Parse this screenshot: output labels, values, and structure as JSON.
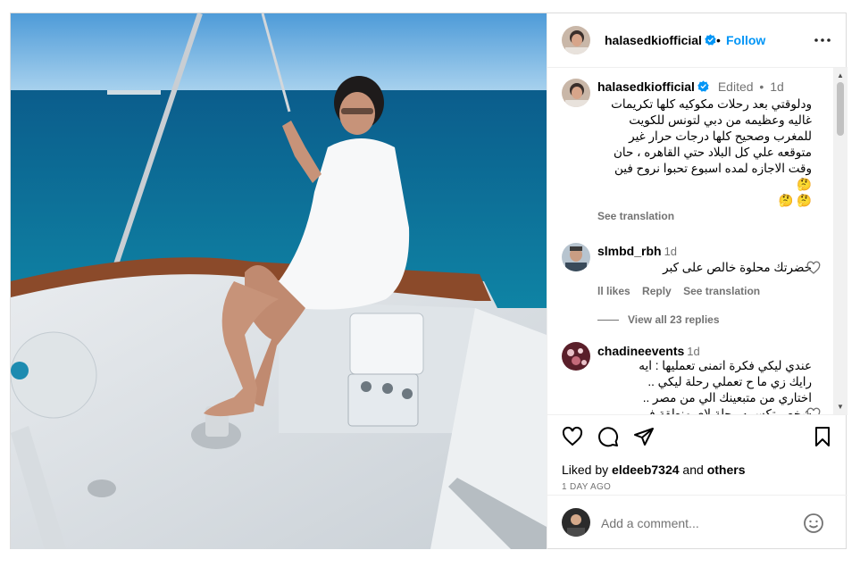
{
  "header": {
    "username": "halasedkiofficial",
    "separator": "•",
    "follow_label": "Follow"
  },
  "caption": {
    "username": "halasedkiofficial",
    "edited": "Edited",
    "dot": "•",
    "time": "1d",
    "lines": [
      "ودلوقتي بعد رحلات مكوكيه كلها تكريمات",
      "غاليه وعظيمه من دبي لتونس للكويت",
      "للمغرب وصحيح كلها درجات حرار غير",
      "متوقعه علي كل البلاد حتي القاهره ، حان",
      "وقت الاجازه لمده اسبوع تحبوا نروح فين 🤔",
      "🤔 🤔"
    ],
    "see_translation": "See translation"
  },
  "comments": [
    {
      "username": "slmbd_rbh",
      "time": "1d",
      "text": "حضرتك محلوة خالص على كبر",
      "likes": "‍ll likes",
      "reply": "Reply",
      "see_translation": "See translation",
      "view_replies": "View all 23 replies"
    },
    {
      "username": "chadineevents",
      "time": "1d",
      "lines": [
        "عندي ليكي فكرة اتمنى تعمليها : ايه",
        "رايك زي ما ح تعملي رحلة ليكي ..",
        "اختاري من متبعينك الي من مصر ..",
        "شخص تكسبيه رحلة لاي منطقة في"
      ]
    }
  ],
  "actions": {
    "liked_by_prefix": "Liked by ",
    "liked_by_user": "eldeeb7324",
    "liked_by_and": " and ",
    "liked_by_others": "others",
    "time_ago": "1 DAY AGO"
  },
  "add_comment": {
    "placeholder": "Add a comment..."
  },
  "colors": {
    "accent": "#0095f6",
    "secondary_text": "#737373",
    "border": "#dbdbdb"
  }
}
